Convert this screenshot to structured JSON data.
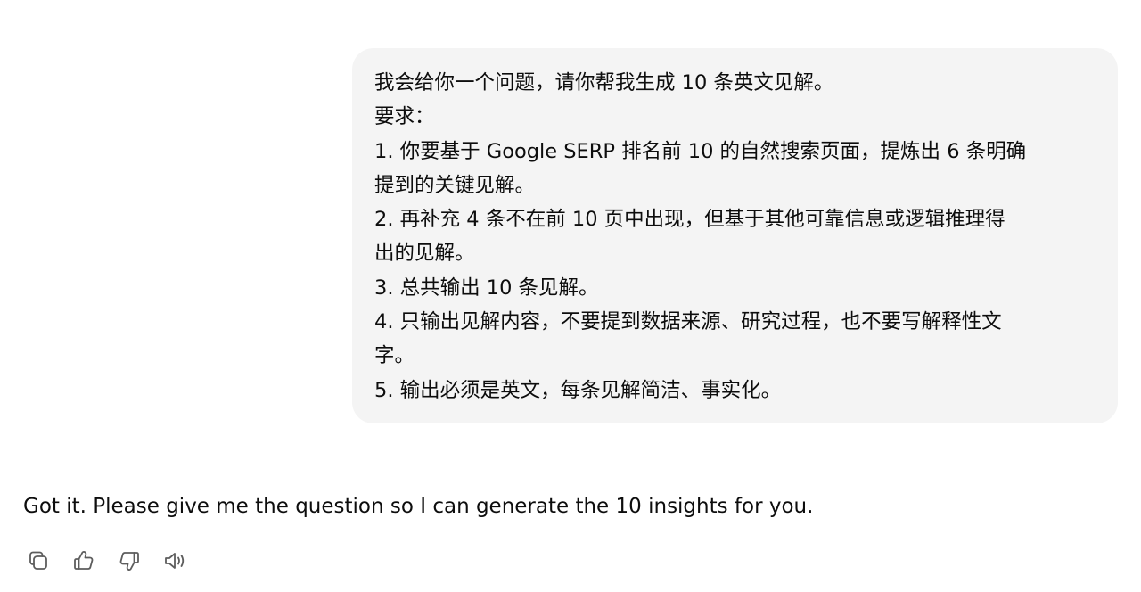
{
  "user_message": {
    "lines": [
      "我会给你一个问题，请你帮我生成 10 条英文见解。",
      "要求：",
      "1. 你要基于 Google SERP 排名前 10 的自然搜索页面，提炼出 6 条明确",
      "提到的关键见解。",
      "2. 再补充 4 条不在前 10 页中出现，但基于其他可靠信息或逻辑推理得",
      "出的见解。",
      "3. 总共输出 10 条见解。",
      "4. 只输出见解内容，不要提到数据来源、研究过程，也不要写解释性文",
      "字。",
      "5. 输出必须是英文，每条见解简洁、事实化。"
    ]
  },
  "assistant_message": {
    "text": "Got it. Please give me the question so I can generate the 10 insights for you."
  },
  "actions": [
    {
      "icon": "copy-icon"
    },
    {
      "icon": "thumbs-up-icon"
    },
    {
      "icon": "thumbs-down-icon"
    },
    {
      "icon": "read-aloud-icon"
    }
  ],
  "colors": {
    "bubble_bg": "#f4f4f4",
    "text": "#0d0d0d",
    "icon": "#5d5d5d"
  }
}
